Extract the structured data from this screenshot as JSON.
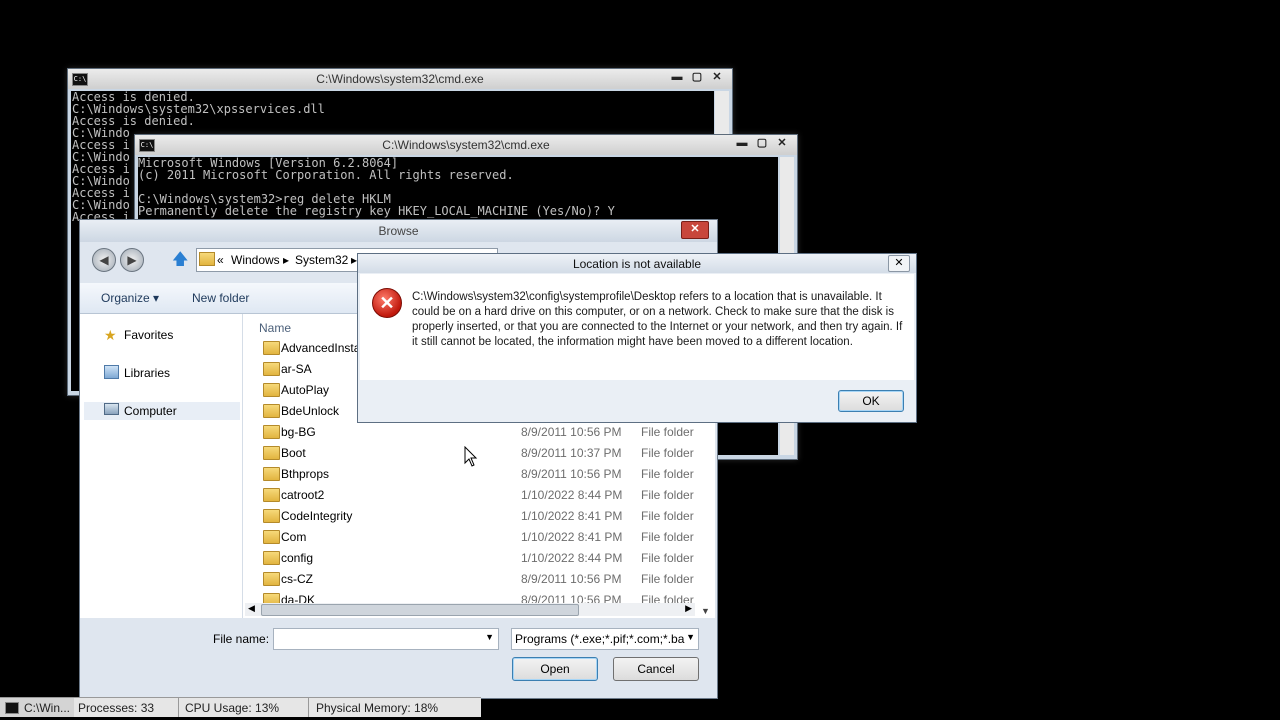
{
  "cmd_back": {
    "title": "C:\\Windows\\system32\\cmd.exe",
    "icon": "C:\\",
    "lines": [
      "Access is denied.",
      "C:\\Windows\\system32\\xpsservices.dll",
      "Access is denied.",
      "C:\\Windo",
      "Access i",
      "C:\\Windo",
      "Access i",
      "C:\\Windo",
      "Access i",
      "C:\\Windo",
      "Access i"
    ]
  },
  "cmd_front": {
    "title": "C:\\Windows\\system32\\cmd.exe",
    "lines": [
      "Microsoft Windows [Version 6.2.8064]",
      "(c) 2011 Microsoft Corporation. All rights reserved.",
      "",
      "C:\\Windows\\system32>reg delete HKLM",
      "Permanently delete the registry key HKEY_LOCAL_MACHINE (Yes/No)? Y"
    ]
  },
  "browse": {
    "title": "Browse",
    "breadcrumb": [
      "«",
      "Windows",
      "System32"
    ],
    "toolbar": {
      "organize": "Organize ▾",
      "new_folder": "New folder"
    },
    "nav": {
      "favorites": "Favorites",
      "libraries": "Libraries",
      "computer": "Computer"
    },
    "column_name": "Name",
    "files": [
      {
        "name": "AdvancedInstall",
        "date": "",
        "type": ""
      },
      {
        "name": "ar-SA",
        "date": "",
        "type": ""
      },
      {
        "name": "AutoPlay",
        "date": "",
        "type": ""
      },
      {
        "name": "BdeUnlock",
        "date": "",
        "type": ""
      },
      {
        "name": "bg-BG",
        "date": "8/9/2011 10:56 PM",
        "type": "File folder"
      },
      {
        "name": "Boot",
        "date": "8/9/2011 10:37 PM",
        "type": "File folder"
      },
      {
        "name": "Bthprops",
        "date": "8/9/2011 10:56 PM",
        "type": "File folder"
      },
      {
        "name": "catroot2",
        "date": "1/10/2022 8:44 PM",
        "type": "File folder"
      },
      {
        "name": "CodeIntegrity",
        "date": "1/10/2022 8:41 PM",
        "type": "File folder"
      },
      {
        "name": "Com",
        "date": "1/10/2022 8:41 PM",
        "type": "File folder"
      },
      {
        "name": "config",
        "date": "1/10/2022 8:44 PM",
        "type": "File folder"
      },
      {
        "name": "cs-CZ",
        "date": "8/9/2011 10:56 PM",
        "type": "File folder"
      },
      {
        "name": "da-DK",
        "date": "8/9/2011 10:56 PM",
        "type": "File folder"
      }
    ],
    "filename_label": "File name:",
    "filename_value": "",
    "filter_value": "Programs (*.exe;*.pif;*.com;*.ba",
    "open_label": "Open",
    "cancel_label": "Cancel"
  },
  "error_dialog": {
    "title": "Location is not available",
    "message": "C:\\Windows\\system32\\config\\systemprofile\\Desktop refers to a location that is unavailable. It could be on a hard drive on this computer, or on a network. Check to make sure that the disk is properly inserted, or that you are connected to the Internet or your network, and then try again. If it still cannot be located, the information might have been moved to a different location.",
    "ok_label": "OK"
  },
  "status": {
    "processes": "Processes: 33",
    "cpu": "CPU Usage: 13%",
    "memory": "Physical Memory: 18%"
  },
  "taskbar": {
    "cmd_button": "C:\\Win..."
  }
}
